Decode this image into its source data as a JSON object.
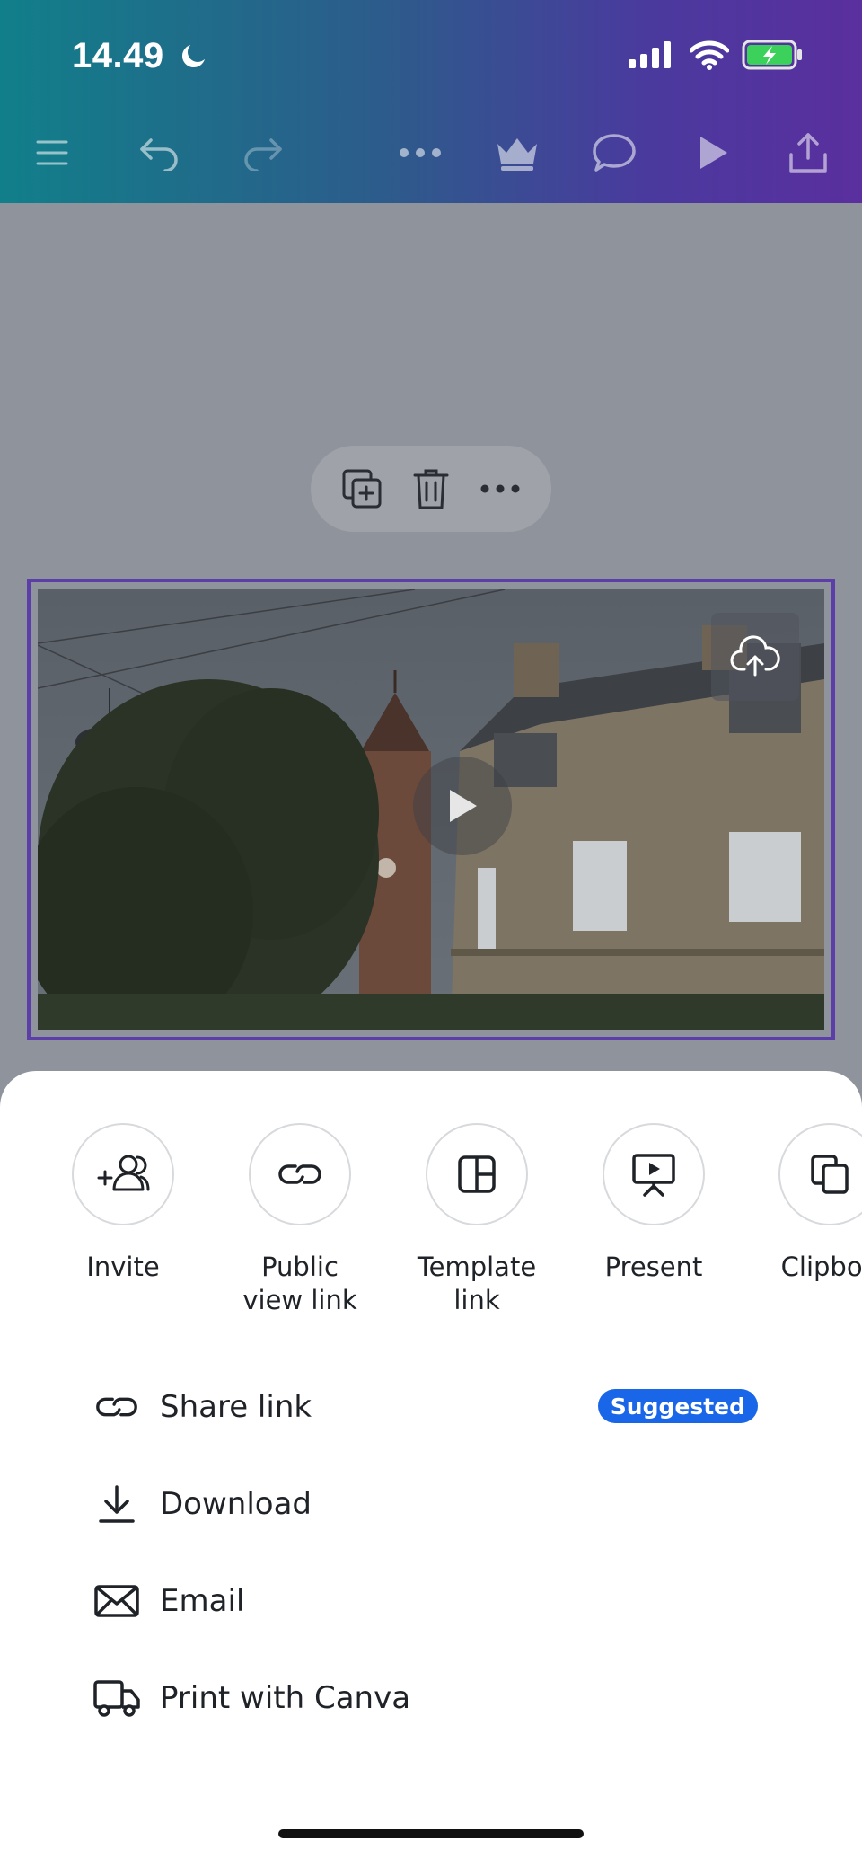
{
  "status": {
    "time": "14.49"
  },
  "toolbar": {
    "icons": [
      "menu-icon",
      "undo-icon",
      "redo-icon",
      "more-icon",
      "crown-icon",
      "comment-icon",
      "play-icon",
      "share-icon"
    ]
  },
  "context_menu": {
    "icons": [
      "duplicate-icon",
      "delete-icon",
      "more-icon"
    ]
  },
  "share_options": [
    {
      "label": "Invite",
      "icon": "invite-people-icon"
    },
    {
      "label": "Public\nview link",
      "icon": "link-icon"
    },
    {
      "label": "Template\nlink",
      "icon": "template-icon"
    },
    {
      "label": "Present",
      "icon": "present-icon"
    },
    {
      "label": "Clipboa",
      "icon": "clipboard-icon"
    }
  ],
  "actions": [
    {
      "label": "Share link",
      "icon": "link-icon",
      "badge": "Suggested"
    },
    {
      "label": "Download",
      "icon": "download-icon"
    },
    {
      "label": "Email",
      "icon": "email-icon"
    },
    {
      "label": "Print with Canva",
      "icon": "truck-icon"
    }
  ],
  "colors": {
    "accent": "#5b3ea8",
    "badge": "#1a66e8",
    "gradient_start": "#117f8a",
    "gradient_end": "#5a2f9e"
  }
}
